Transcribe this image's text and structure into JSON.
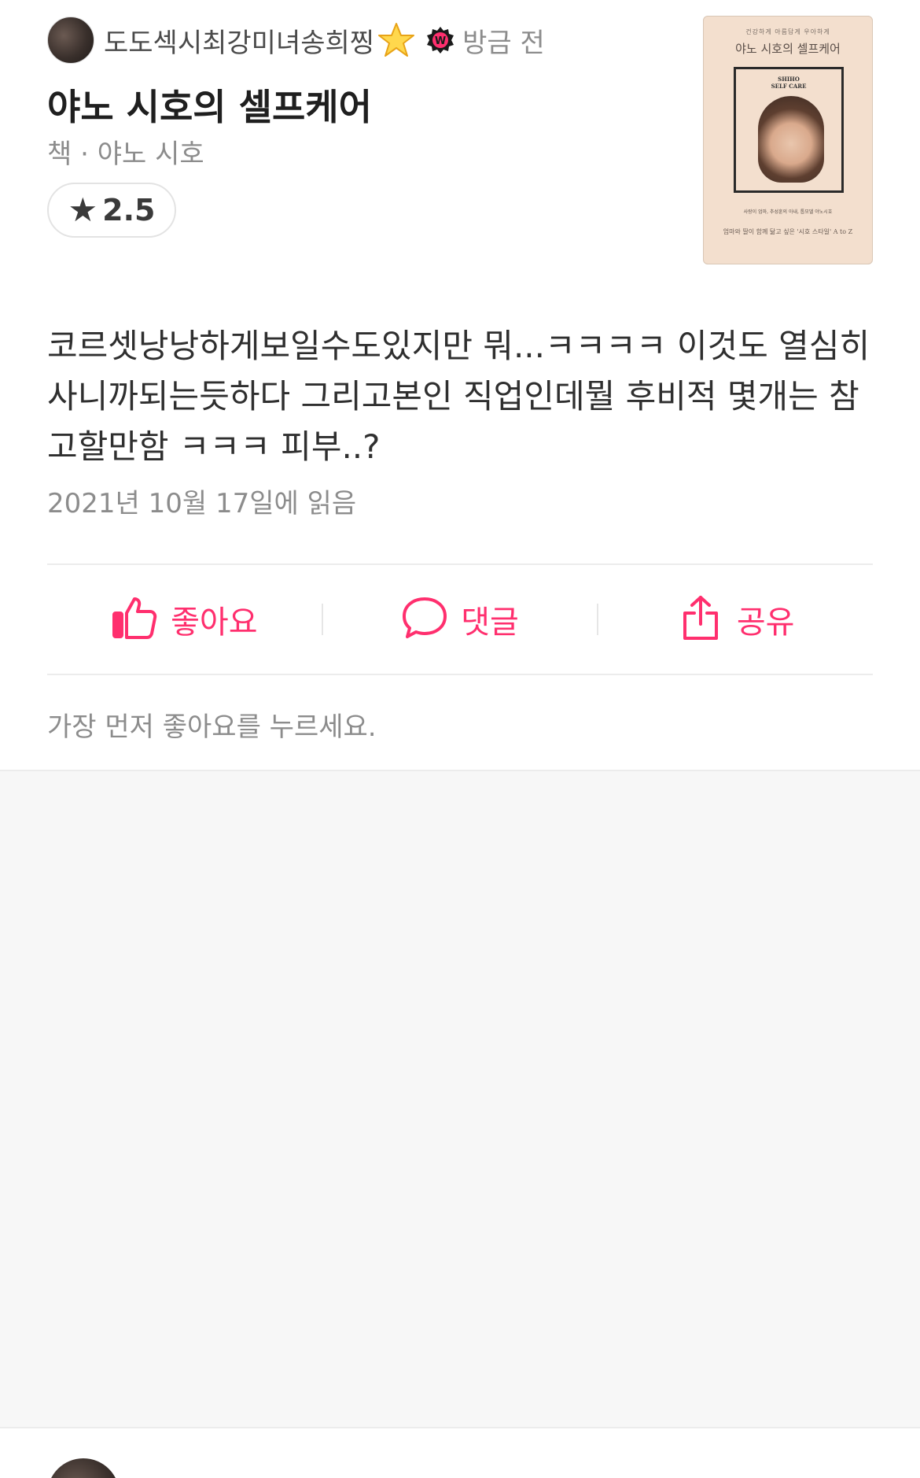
{
  "post": {
    "username": "도도섹시최강미녀송희찡",
    "time": "방금 전",
    "title": "야노 시호의 셀프케어",
    "meta": "책 · 야노 시호",
    "rating": "2.5",
    "body": "코르셋낭낭하게보일수도있지만 뭐...ㅋㅋㅋㅋ 이것도 열심히 사니까되는듯하다 그리고본인 직업인데뭘 후비적 몇개는 참고할만함 ㅋㅋㅋ 피부..?",
    "read_date": "2021년 10월 17일에 읽음"
  },
  "cover": {
    "top_text": "건강하게 아름답게 우아하게",
    "title": "야노 시호의 셀프케어",
    "en_title_line1": "SHIHO",
    "en_title_line2": "SELF CARE",
    "sub_text": "사랑이 엄마, 추성훈의 아내, 톱모델 야노시호",
    "bottom_text": "엄마와 딸이 함께 닮고 싶은 '시호 스타일' A to Z"
  },
  "actions": {
    "like_label": "좋아요",
    "comment_label": "댓글",
    "share_label": "공유"
  },
  "likes_hint": "가장 먼저 좋아요를 누르세요.",
  "icons": {
    "like": "thumbs-up-icon",
    "comment": "speech-bubble-icon",
    "share": "share-icon",
    "rating": "star-icon"
  },
  "colors": {
    "accent": "#ff2f6e",
    "gray_text": "#8c8c8c"
  }
}
